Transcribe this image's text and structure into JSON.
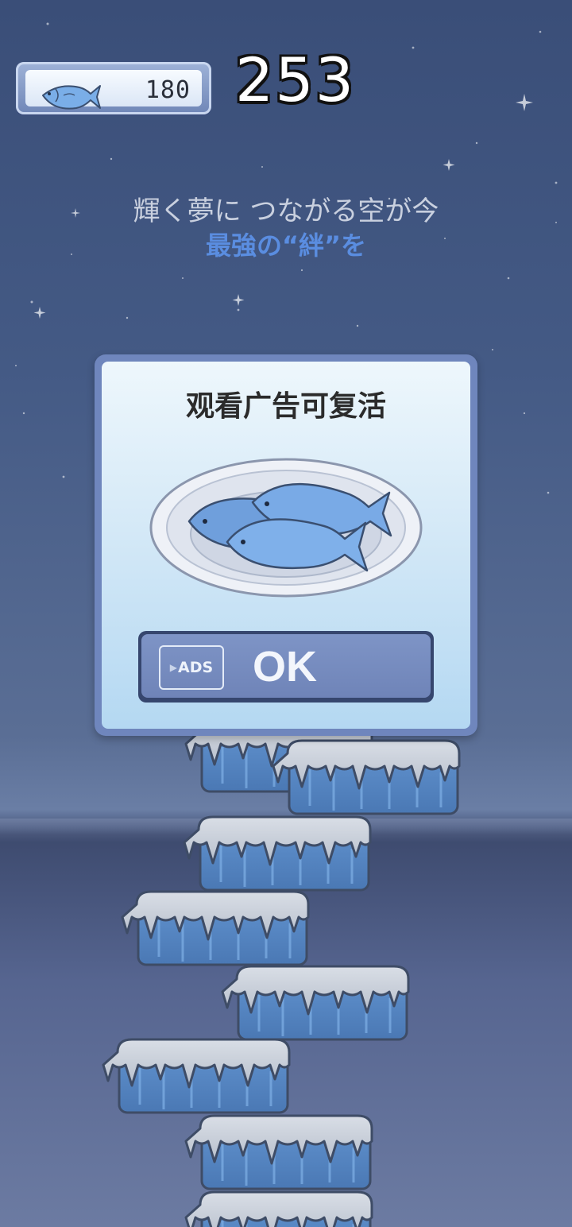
{
  "hud": {
    "fish_count": "180",
    "score": "253"
  },
  "lyrics": {
    "line1": "輝く夢に つながる空が今",
    "line2": "最強の“絆”を"
  },
  "dialog": {
    "title": "观看广告可复活",
    "ads_label": "ADS",
    "ok_label": "OK"
  },
  "icons": {
    "fish": "fish-icon",
    "plate": "fish-plate-icon",
    "ads": "play-icon"
  },
  "colors": {
    "accent": "#5a8de0",
    "button": "#6f84b8",
    "modal_border": "#6f86bd",
    "ice": "#6d9fd6"
  }
}
